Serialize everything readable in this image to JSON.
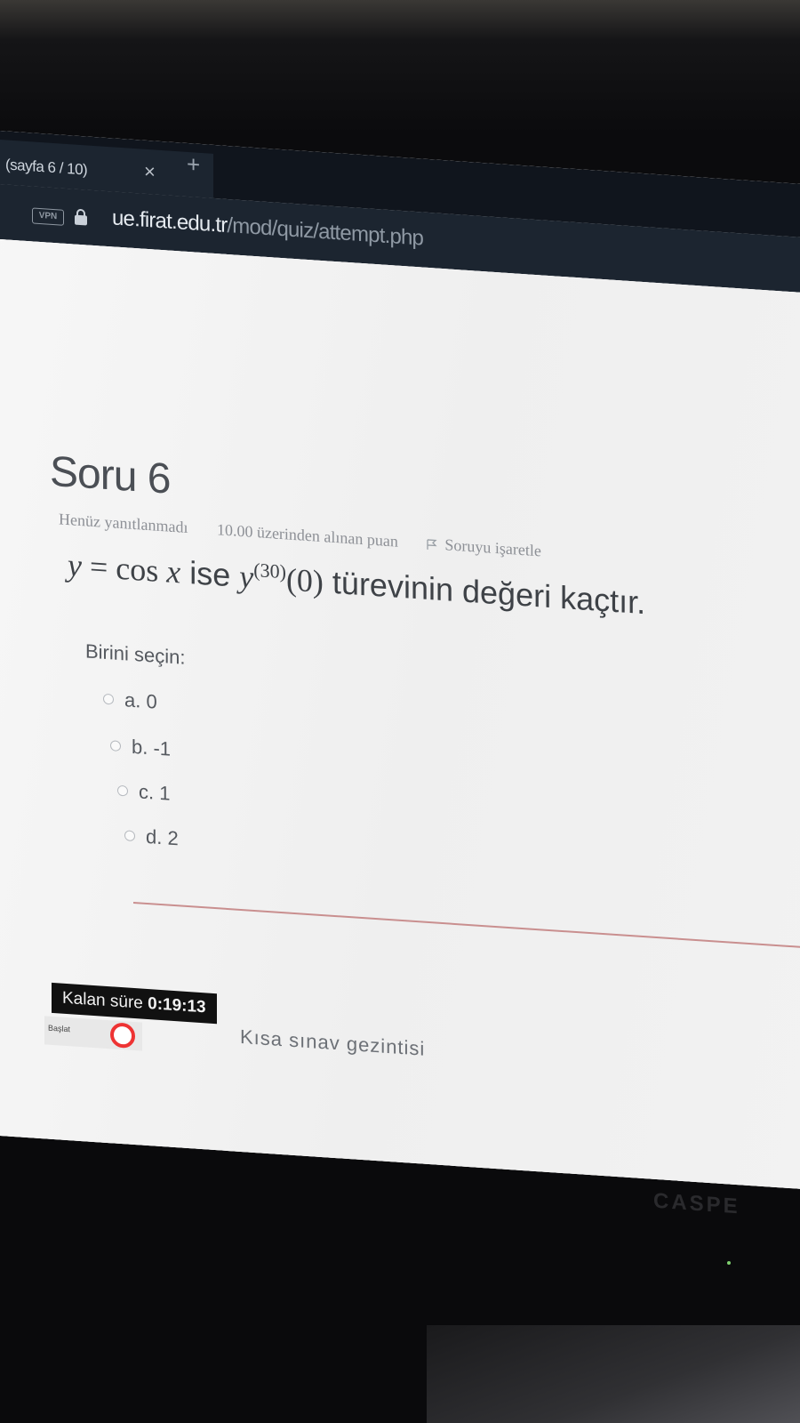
{
  "browser": {
    "tab_title": "(sayfa 6 / 10)",
    "tab_close": "×",
    "tab_new": "+",
    "vpn_badge": "VPN",
    "url_host": "ue.firat.edu.tr",
    "url_path": "/mod/quiz/attempt.php"
  },
  "question": {
    "title": "Soru 6",
    "status": "Henüz yanıtlanmadı",
    "points": "10.00 üzerinden alınan puan",
    "flag_label": "Soruyu işaretle",
    "text_y": "y",
    "text_eq": " = cos ",
    "text_x": "x",
    "text_ise": " ise ",
    "text_y2": "y",
    "text_exp": "(30)",
    "text_arg": "(0)",
    "text_rest": " türevinin değeri kaçtır.",
    "prompt": "Birini seçin:",
    "options": [
      {
        "label": "a. 0"
      },
      {
        "label": "b. -1"
      },
      {
        "label": "c. 1"
      },
      {
        "label": "d. 2"
      }
    ]
  },
  "timer": {
    "label": "Kalan süre ",
    "value": "0:19:13"
  },
  "navigation": {
    "label": "Kısa sınav gezintisi"
  },
  "taskbar": {
    "start_label": "Başlat"
  },
  "monitor": {
    "brand": "CASPE"
  },
  "colors": {
    "tab_bar": "#10151d",
    "address_bar": "#1c2530",
    "page_bg": "#f4f4f4",
    "timer_bg": "#111111",
    "divider": "#c98f8f"
  }
}
